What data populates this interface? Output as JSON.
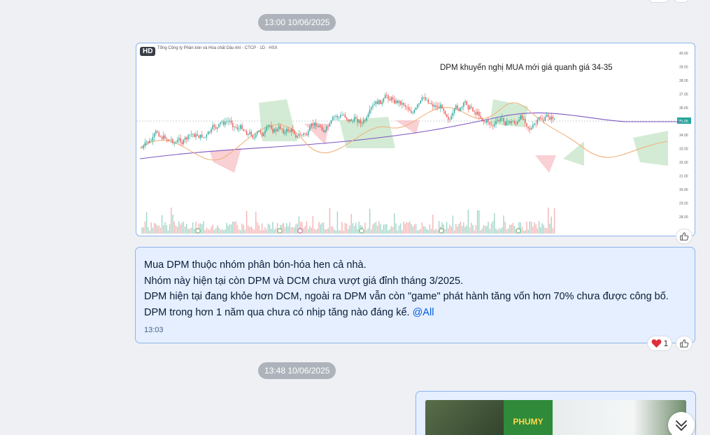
{
  "timestamps": [
    "13:00 10/06/2025",
    "13:48 10/06/2025"
  ],
  "image_message": {
    "badge": "HD",
    "chart_header": "Tổng Công ty Phân bón và Hóa chất Dầu khí - CTCP · 1D · HSX",
    "chart_annotation": "DPM khuyến nghị MUA mới giá quanh giá 34-35",
    "price_tag": "35.05",
    "price_axis": [
      "40.00",
      "39.00",
      "38.00",
      "37.00",
      "36.00",
      "35.00",
      "34.00",
      "33.00",
      "32.00",
      "31.00",
      "30.00",
      "29.00",
      "28.00"
    ]
  },
  "text_message": {
    "lines": [
      "Mua DPM thuộc nhóm phân bón-hóa hen cả nhà.",
      "Nhóm này hiện tại còn DPM và DCM chưa vượt giá đỉnh tháng 3/2025.",
      "DPM hiện tại đang khỏe hơn DCM, ngoài ra DPM vẫn còn \"game\" phát hành tăng vốn hơn 70% chưa được công bố.",
      "DPM trong hơn 1 năm qua chưa có nhịp tăng nào đáng kể. "
    ],
    "mention": "@All",
    "time": "13:03",
    "reaction_count": "1"
  },
  "photo_message": {
    "sign_text": "PHUMY"
  },
  "icons": {
    "like": "thumbs-up-icon",
    "heart": "heart-icon",
    "scroll": "double-chevron-down-icon"
  },
  "colors": {
    "bubble_bg": "#e5efff",
    "bubble_border": "#8cb4ee",
    "candle_up": "#26a69a",
    "candle_down": "#ef5350",
    "mention": "#005ae0"
  }
}
